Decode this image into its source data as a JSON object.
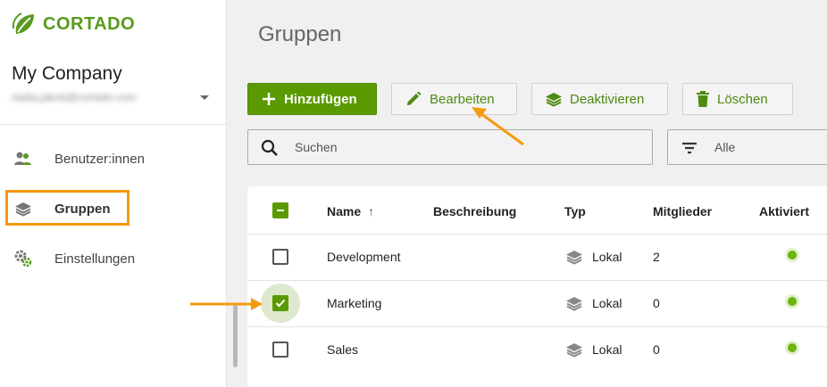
{
  "brand": {
    "name": "CORTADO",
    "accent_color": "#5a9a00",
    "highlight_color": "#f59a0e"
  },
  "sidebar": {
    "company_name": "My Company",
    "company_email": "nadia.jakob@cortado.com",
    "company_chevron_icon": "chevron-down-icon",
    "items": [
      {
        "label": "Benutzer:innen",
        "icon": "users-icon",
        "active": false
      },
      {
        "label": "Gruppen",
        "icon": "layers-icon",
        "active": true
      },
      {
        "label": "Einstellungen",
        "icon": "gear-icon",
        "active": false
      }
    ]
  },
  "main": {
    "title": "Gruppen",
    "toolbar": {
      "add_label": "Hinzufügen",
      "edit_label": "Bearbeiten",
      "deactivate_label": "Deaktivieren",
      "delete_label": "Löschen"
    },
    "search": {
      "placeholder": "Suchen",
      "icon": "search-icon"
    },
    "filter": {
      "value": "Alle",
      "icon": "filter-icon"
    },
    "table": {
      "columns": [
        "Name",
        "Beschreibung",
        "Typ",
        "Mitglieder",
        "Aktiviert"
      ],
      "sort_indicator": "↑",
      "rows": [
        {
          "name": "Development",
          "description": "",
          "type": "Lokal",
          "members": "2",
          "active": true,
          "selected": false
        },
        {
          "name": "Marketing",
          "description": "",
          "type": "Lokal",
          "members": "0",
          "active": true,
          "selected": true
        },
        {
          "name": "Sales",
          "description": "",
          "type": "Lokal",
          "members": "0",
          "active": true,
          "selected": false
        }
      ]
    }
  }
}
